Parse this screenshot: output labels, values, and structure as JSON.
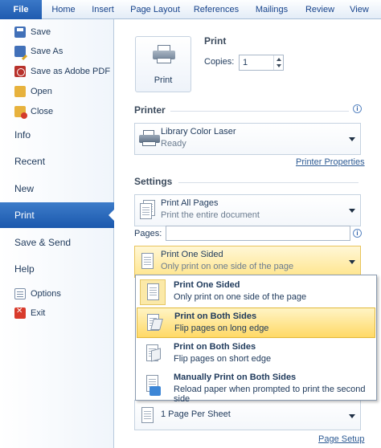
{
  "ribbon": {
    "tabs": [
      "File",
      "Home",
      "Insert",
      "Page Layout",
      "References",
      "Mailings",
      "Review",
      "View"
    ]
  },
  "backstage": {
    "commands_top": [
      {
        "label": "Save",
        "icon": "save-icon"
      },
      {
        "label": "Save As",
        "icon": "save-as-icon"
      },
      {
        "label": "Save as Adobe PDF",
        "icon": "pdf-icon"
      },
      {
        "label": "Open",
        "icon": "open-folder-icon"
      },
      {
        "label": "Close",
        "icon": "close-folder-icon"
      }
    ],
    "tabs": [
      "Info",
      "Recent",
      "New",
      "Print",
      "Save & Send",
      "Help"
    ],
    "active_tab": "Print",
    "commands_bottom": [
      {
        "label": "Options",
        "icon": "options-icon"
      },
      {
        "label": "Exit",
        "icon": "exit-icon"
      }
    ]
  },
  "print": {
    "heading": "Print",
    "button_label": "Print",
    "copies_label": "Copies:",
    "copies_value": "1"
  },
  "printer": {
    "heading": "Printer",
    "name": "Library Color Laser",
    "status": "Ready",
    "properties_link": "Printer Properties"
  },
  "settings": {
    "heading": "Settings",
    "range": {
      "title": "Print All Pages",
      "desc": "Print the entire document"
    },
    "pages_label": "Pages:",
    "pages_value": "",
    "sides": {
      "title": "Print One Sided",
      "desc": "Only print on one side of the page"
    },
    "per_sheet": {
      "title": "1 Page Per Sheet"
    },
    "page_setup_link": "Page Setup"
  },
  "sides_menu": [
    {
      "title": "Print One Sided",
      "desc": "Only print on one side of the page"
    },
    {
      "title": "Print on Both Sides",
      "desc": "Flip pages on long edge"
    },
    {
      "title": "Print on Both Sides",
      "desc": "Flip pages on short edge"
    },
    {
      "title": "Manually Print on Both Sides",
      "desc": "Reload paper when prompted to print the second side"
    }
  ],
  "colors": {
    "file_tab": "#2a67bd",
    "active_nav": "#2a67bd",
    "highlight": "#ffe58c"
  }
}
